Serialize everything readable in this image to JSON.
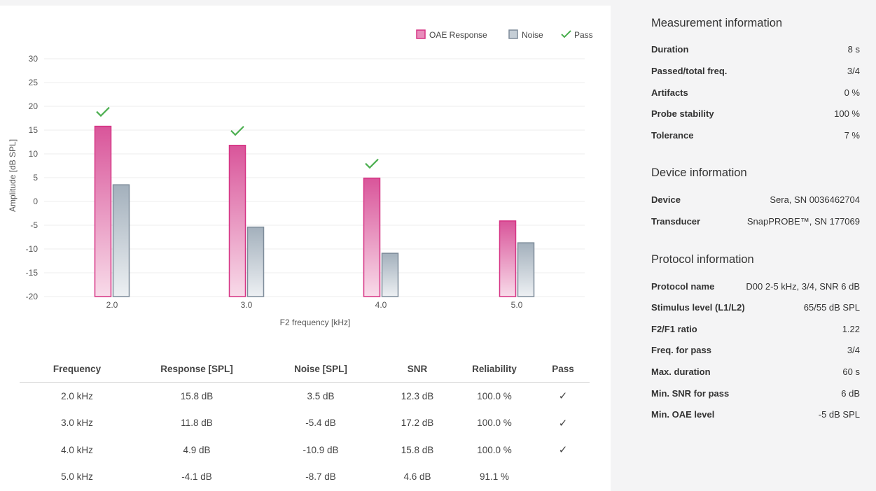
{
  "legend": {
    "response_label": "OAE Response",
    "noise_label": "Noise",
    "pass_label": "Pass",
    "response_color": "#d63384",
    "noise_color": "#8796a4",
    "pass_color": "#4caf50"
  },
  "chart_data": {
    "type": "bar",
    "categories": [
      "2.0",
      "3.0",
      "4.0",
      "5.0"
    ],
    "series": [
      {
        "name": "OAE Response",
        "values": [
          15.8,
          11.8,
          4.9,
          -4.1
        ]
      },
      {
        "name": "Noise",
        "values": [
          3.5,
          -5.4,
          -10.9,
          -8.7
        ]
      }
    ],
    "pass": [
      true,
      true,
      true,
      false
    ],
    "xlabel": "F2 frequency [kHz]",
    "ylabel": "Amplitude [dB SPL]",
    "ylim": [
      -20,
      30
    ],
    "yticks": [
      "30",
      "25",
      "20",
      "15",
      "10",
      "5",
      "0",
      "-5",
      "-10",
      "-15",
      "-20"
    ],
    "grid": true,
    "legend_position": "top-right"
  },
  "table": {
    "headers": [
      "Frequency",
      "Response [SPL]",
      "Noise [SPL]",
      "SNR",
      "Reliability",
      "Pass"
    ],
    "rows": [
      {
        "frequency": "2.0 kHz",
        "response": "15.8 dB",
        "noise": "3.5 dB",
        "snr": "12.3 dB",
        "reliability": "100.0 %",
        "pass": "✓"
      },
      {
        "frequency": "3.0 kHz",
        "response": "11.8 dB",
        "noise": "-5.4 dB",
        "snr": "17.2 dB",
        "reliability": "100.0 %",
        "pass": "✓"
      },
      {
        "frequency": "4.0 kHz",
        "response": "4.9 dB",
        "noise": "-10.9 dB",
        "snr": "15.8 dB",
        "reliability": "100.0 %",
        "pass": "✓"
      },
      {
        "frequency": "5.0 kHz",
        "response": "-4.1 dB",
        "noise": "-8.7 dB",
        "snr": "4.6 dB",
        "reliability": "91.1 %",
        "pass": ""
      }
    ]
  },
  "measurement": {
    "title": "Measurement information",
    "items": [
      {
        "key": "Duration",
        "value": "8 s"
      },
      {
        "key": "Passed/total freq.",
        "value": "3/4"
      },
      {
        "key": "Artifacts",
        "value": "0 %"
      },
      {
        "key": "Probe stability",
        "value": "100 %"
      },
      {
        "key": "Tolerance",
        "value": "7 %"
      }
    ]
  },
  "device": {
    "title": "Device information",
    "items": [
      {
        "key": "Device",
        "value": "Sera, SN 0036462704"
      },
      {
        "key": "Transducer",
        "value": "SnapPROBE™, SN 177069"
      }
    ]
  },
  "protocol": {
    "title": "Protocol information",
    "items": [
      {
        "key": "Protocol name",
        "value": "D00 2-5 kHz, 3/4, SNR 6 dB"
      },
      {
        "key": "Stimulus level (L1/L2)",
        "value": "65/55 dB SPL"
      },
      {
        "key": "F2/F1 ratio",
        "value": "1.22"
      },
      {
        "key": "Freq. for pass",
        "value": "3/4"
      },
      {
        "key": "Max. duration",
        "value": "60 s"
      },
      {
        "key": "Min. SNR for pass",
        "value": "6 dB"
      },
      {
        "key": "Min. OAE level",
        "value": "-5 dB SPL"
      }
    ]
  }
}
